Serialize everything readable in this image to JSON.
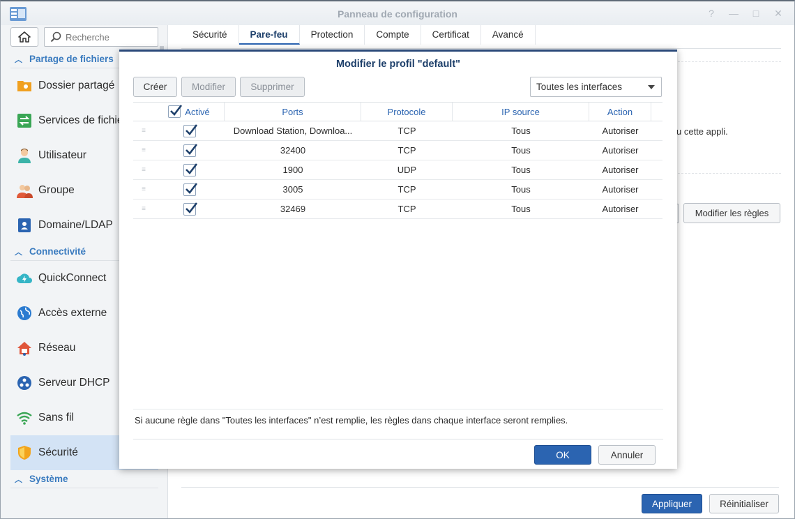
{
  "window": {
    "title": "Panneau de configuration",
    "controls": [
      "?",
      "—",
      "□",
      "✕"
    ]
  },
  "sidebar": {
    "search_placeholder": "Recherche",
    "sections": [
      {
        "label": "Partage de fichiers",
        "items": [
          {
            "label": "Dossier partagé",
            "icon": "shared-folder-icon"
          },
          {
            "label": "Services de fichiers",
            "icon": "file-services-icon"
          },
          {
            "label": "Utilisateur",
            "icon": "user-icon"
          },
          {
            "label": "Groupe",
            "icon": "group-icon"
          },
          {
            "label": "Domaine/LDAP",
            "icon": "domain-ldap-icon"
          }
        ]
      },
      {
        "label": "Connectivité",
        "items": [
          {
            "label": "QuickConnect",
            "icon": "quickconnect-icon"
          },
          {
            "label": "Accès externe",
            "icon": "external-access-icon"
          },
          {
            "label": "Réseau",
            "icon": "network-icon"
          },
          {
            "label": "Serveur DHCP",
            "icon": "dhcp-server-icon"
          },
          {
            "label": "Sans fil",
            "icon": "wireless-icon"
          },
          {
            "label": "Sécurité",
            "icon": "security-shield-icon",
            "active": true
          }
        ]
      },
      {
        "label": "Système",
        "items": []
      }
    ]
  },
  "tabs": [
    "Sécurité",
    "Pare-feu",
    "Protection",
    "Compte",
    "Certificat",
    "Avancé"
  ],
  "active_tab": "Pare-feu",
  "behind": {
    "text": "u cette appli.",
    "edit_rules_label": "Modifier les règles"
  },
  "footer": {
    "apply_label": "Appliquer",
    "reset_label": "Réinitialiser"
  },
  "modal": {
    "title": "Modifier le profil \"default\"",
    "create_label": "Créer",
    "modify_label": "Modifier",
    "delete_label": "Supprimer",
    "interface_select": "Toutes les interfaces",
    "columns": {
      "active": "Activé",
      "ports": "Ports",
      "protocol": "Protocole",
      "source_ip": "IP source",
      "action": "Action"
    },
    "rules": [
      {
        "active": true,
        "ports": "Download Station, Downloa...",
        "protocol": "TCP",
        "source_ip": "Tous",
        "action": "Autoriser"
      },
      {
        "active": true,
        "ports": "32400",
        "protocol": "TCP",
        "source_ip": "Tous",
        "action": "Autoriser"
      },
      {
        "active": true,
        "ports": "1900",
        "protocol": "UDP",
        "source_ip": "Tous",
        "action": "Autoriser"
      },
      {
        "active": true,
        "ports": "3005",
        "protocol": "TCP",
        "source_ip": "Tous",
        "action": "Autoriser"
      },
      {
        "active": true,
        "ports": "32469",
        "protocol": "TCP",
        "source_ip": "Tous",
        "action": "Autoriser"
      }
    ],
    "note": "Si aucune règle dans \"Toutes les interfaces\" n’est remplie, les règles dans chaque interface seront remplies.",
    "ok_label": "OK",
    "cancel_label": "Annuler"
  }
}
